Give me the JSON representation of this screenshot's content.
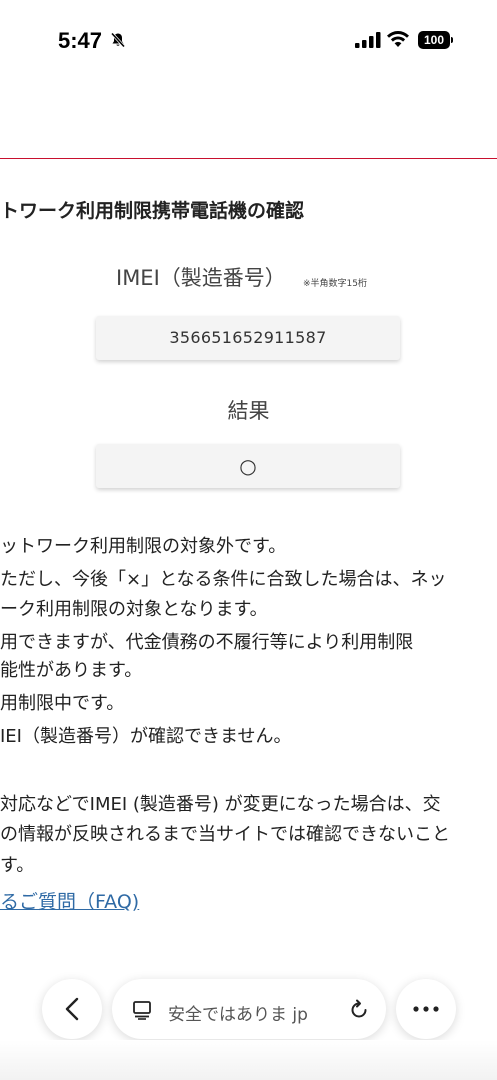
{
  "status_bar": {
    "time": "5:47",
    "battery": "100",
    "icons": [
      "bell-slash-icon",
      "cellular-signal-icon",
      "wifi-icon",
      "battery-icon"
    ]
  },
  "colors": {
    "header_rule": "#c8102e",
    "link": "#2f6aa5",
    "box_background": "#f4f4f4"
  },
  "checker": {
    "title": "トワーク利用制限携帯電話機の確認",
    "imei_label": "IMEI（製造番号）",
    "imei_note": "※半角数字15桁",
    "imei_value": "356651652911587",
    "result_label": "結果",
    "result_value": "○"
  },
  "legend": [
    "ットワーク利用制限の対象外です。",
    "ただし、今後「×」となる条件に合致した場合は、ネッ",
    "ーク利用制限の対象となります。",
    "用できますが、代金債務の不履行等により利用制限",
    "能性があります。",
    "用制限中です。",
    "IEI（製造番号）が確認できません。"
  ],
  "notes": [
    "対応などでIMEI (製造番号) が変更になった場合は、交",
    "の情報が反映されるまで当サイトでは確認できないこと",
    "す。"
  ],
  "faq_link": "るご質問（FAQ)",
  "browser_toolbar": {
    "address_text": "安全ではありま",
    "address_suffix": "jp",
    "icons": [
      "chevron-left-icon",
      "reader-icon",
      "reload-icon",
      "more-icon"
    ]
  }
}
